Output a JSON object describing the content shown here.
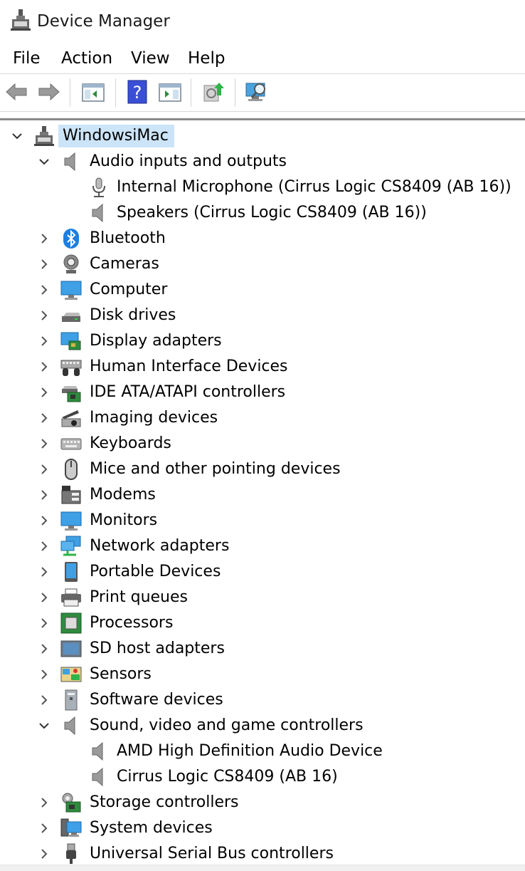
{
  "window": {
    "title": "Device Manager"
  },
  "menu": [
    "File",
    "Action",
    "View",
    "Help"
  ],
  "toolbar": {
    "buttons": [
      "back-icon",
      "forward-icon",
      "properties-pane-icon",
      "help-icon",
      "action-pane-icon",
      "update-driver-icon",
      "scan-hardware-icon"
    ]
  },
  "tree": {
    "root": "WindowsiMac",
    "categories": [
      {
        "label": "Audio inputs and outputs",
        "expanded": true,
        "icon": "speaker-icon",
        "children": [
          {
            "label": "Internal Microphone (Cirrus Logic CS8409 (AB 16))",
            "icon": "microphone-icon"
          },
          {
            "label": "Speakers (Cirrus Logic CS8409 (AB 16))",
            "icon": "speaker-icon"
          }
        ]
      },
      {
        "label": "Bluetooth",
        "expanded": false,
        "icon": "bluetooth-icon"
      },
      {
        "label": "Cameras",
        "expanded": false,
        "icon": "camera-icon"
      },
      {
        "label": "Computer",
        "expanded": false,
        "icon": "computer-icon"
      },
      {
        "label": "Disk drives",
        "expanded": false,
        "icon": "disk-drive-icon"
      },
      {
        "label": "Display adapters",
        "expanded": false,
        "icon": "display-adapter-icon"
      },
      {
        "label": "Human Interface Devices",
        "expanded": false,
        "icon": "hid-icon"
      },
      {
        "label": "IDE ATA/ATAPI controllers",
        "expanded": false,
        "icon": "ide-controller-icon"
      },
      {
        "label": "Imaging devices",
        "expanded": false,
        "icon": "imaging-device-icon"
      },
      {
        "label": "Keyboards",
        "expanded": false,
        "icon": "keyboard-icon"
      },
      {
        "label": "Mice and other pointing devices",
        "expanded": false,
        "icon": "mouse-icon"
      },
      {
        "label": "Modems",
        "expanded": false,
        "icon": "modem-icon"
      },
      {
        "label": "Monitors",
        "expanded": false,
        "icon": "monitor-icon"
      },
      {
        "label": "Network adapters",
        "expanded": false,
        "icon": "network-adapter-icon"
      },
      {
        "label": "Portable Devices",
        "expanded": false,
        "icon": "portable-device-icon"
      },
      {
        "label": "Print queues",
        "expanded": false,
        "icon": "printer-icon"
      },
      {
        "label": "Processors",
        "expanded": false,
        "icon": "processor-icon"
      },
      {
        "label": "SD host adapters",
        "expanded": false,
        "icon": "sd-host-icon"
      },
      {
        "label": "Sensors",
        "expanded": false,
        "icon": "sensor-icon"
      },
      {
        "label": "Software devices",
        "expanded": false,
        "icon": "software-device-icon"
      },
      {
        "label": "Sound, video and game controllers",
        "expanded": true,
        "icon": "speaker-icon",
        "children": [
          {
            "label": "AMD High Definition Audio Device",
            "icon": "speaker-icon"
          },
          {
            "label": "Cirrus Logic CS8409 (AB 16)",
            "icon": "speaker-icon"
          }
        ]
      },
      {
        "label": "Storage controllers",
        "expanded": false,
        "icon": "storage-controller-icon"
      },
      {
        "label": "System devices",
        "expanded": false,
        "icon": "system-device-icon"
      },
      {
        "label": "Universal Serial Bus controllers",
        "expanded": false,
        "icon": "usb-icon"
      }
    ]
  }
}
